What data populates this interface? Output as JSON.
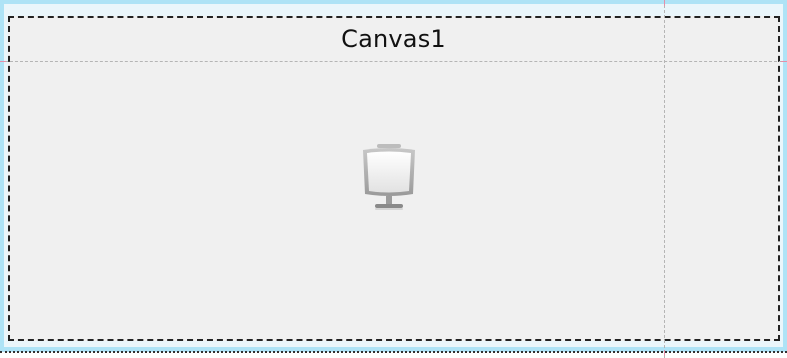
{
  "canvas": {
    "title": "Canvas1",
    "icon": "monitor-icon"
  }
}
